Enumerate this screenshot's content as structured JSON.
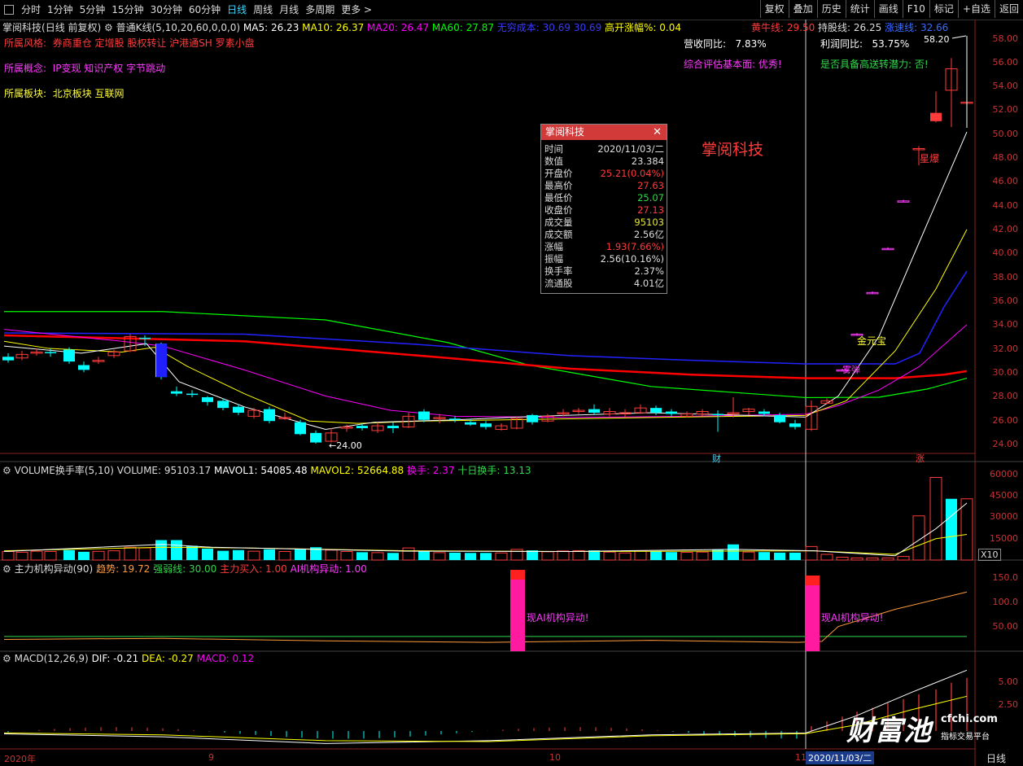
{
  "periods": [
    "分时",
    "1分钟",
    "5分钟",
    "15分钟",
    "30分钟",
    "60分钟",
    "日线",
    "周线",
    "月线",
    "多周期",
    "更多 >"
  ],
  "active_period": "日线",
  "tools": [
    "复权",
    "叠加",
    "历史",
    "统计",
    "画线",
    "F10",
    "标记",
    "+自选",
    "返回"
  ],
  "stock": {
    "name": "掌阅科技",
    "mode": "(日线 前复权)",
    "kline_label": "普通K线(5,10,20,60,0,0,0)",
    "ma5": "MA5: 26.23",
    "ma10": "MA10: 26.37",
    "ma20": "MA20: 26.47",
    "ma60": "MA60: 27.87",
    "cost": "无穷成本: 30.69",
    "cost2": "30.69",
    "gap": "高开涨幅%: 0.04",
    "bull": "黄牛线: 29.50",
    "hold": "持股线: 26.25",
    "rise": "涨速线: 32.66"
  },
  "info": {
    "style_label": "所属风格:",
    "style_value": "券商重仓 定增股 股权转让 沪港通SH 罗素小盘",
    "concept_label": "所属概念:",
    "concept_value": "IP变现 知识产权 字节跳动",
    "sector_label": "所属板块:",
    "sector_value": "北京板块   互联网",
    "revenue_label": "营收同比:",
    "revenue_value": "7.83%",
    "profit_label": "利润同比:",
    "profit_value": "53.75%",
    "eval": "综合评估基本面: 优秀!",
    "transfer": "是否具备高送转潜力: 否!"
  },
  "watermark_name": "掌阅科技",
  "annotations": {
    "low": "←24.00",
    "high": "58.20",
    "gold": "金元宝",
    "bomb": "雾弹",
    "star": "星爆",
    "cai": "财",
    "zhang": "涨"
  },
  "popup": {
    "title": "掌阅科技",
    "rows": [
      {
        "k": "时间",
        "v": "2020/11/03/二",
        "c": "#ddd"
      },
      {
        "k": "数值",
        "v": "23.384",
        "c": "#ddd"
      },
      {
        "k": "开盘价",
        "v": "25.21(0.04%)",
        "c": "#ff3b3b"
      },
      {
        "k": "最高价",
        "v": "27.63",
        "c": "#ff3b3b"
      },
      {
        "k": "最低价",
        "v": "25.07",
        "c": "#2fd94a"
      },
      {
        "k": "收盘价",
        "v": "27.13",
        "c": "#ff3b3b"
      },
      {
        "k": "成交量",
        "v": "95103",
        "c": "#e8e83a"
      },
      {
        "k": "成交额",
        "v": "2.56亿",
        "c": "#ddd"
      },
      {
        "k": "涨幅",
        "v": "1.93(7.66%)",
        "c": "#ff3b3b"
      },
      {
        "k": "振幅",
        "v": "2.56(10.16%)",
        "c": "#ddd"
      },
      {
        "k": "换手率",
        "v": "2.37%",
        "c": "#ddd"
      },
      {
        "k": "流通股",
        "v": "4.01亿",
        "c": "#ddd"
      }
    ]
  },
  "price_axis": [
    "58.00",
    "56.00",
    "54.00",
    "52.00",
    "50.00",
    "48.00",
    "46.00",
    "44.00",
    "42.00",
    "40.00",
    "38.00",
    "36.00",
    "34.00",
    "32.00",
    "30.00",
    "28.00",
    "26.00",
    "24.00"
  ],
  "volume": {
    "title": "VOLUME换手率(5,10)",
    "v": "VOLUME: 95103.17",
    "m1": "MAVOL1: 54085.48",
    "m2": "MAVOL2: 52664.88",
    "hs": "换手: 2.37",
    "hs10": "十日换手: 13.13",
    "axis": [
      "60000",
      "45000",
      "30000",
      "15000",
      "X10"
    ]
  },
  "fund": {
    "title": "主力机构异动(90)",
    "trend": "趋势: 19.72",
    "strong": "强弱线: 30.00",
    "buy": "主力买入: 1.00",
    "ai": "AI机构异动: 1.00",
    "alert": "现AI机构异动!",
    "axis": [
      "150.0",
      "100.0",
      "50.00"
    ]
  },
  "macd": {
    "title": "MACD(12,26,9)",
    "dif": "DIF: -0.21",
    "dea": "DEA: -0.27",
    "m": "MACD: 0.12",
    "axis": [
      "5.00",
      "2.50"
    ]
  },
  "dates": {
    "y2020": "2020年",
    "m9": "9",
    "m10": "10",
    "m11": "11",
    "cursor": "2020/11/03/二",
    "period_tag": "日线"
  },
  "logo": {
    "big": "财富池",
    "site": "cfchi.com",
    "sub": "指标交易平台"
  },
  "colors": {
    "up": "#ff3b3b",
    "down": "#00ffff",
    "ma5": "#ffffff",
    "ma10": "#ffff00",
    "ma20": "#ff00ff",
    "ma60": "#00ff00",
    "red_line": "#ff0000",
    "blue_line": "#0000ff"
  }
}
